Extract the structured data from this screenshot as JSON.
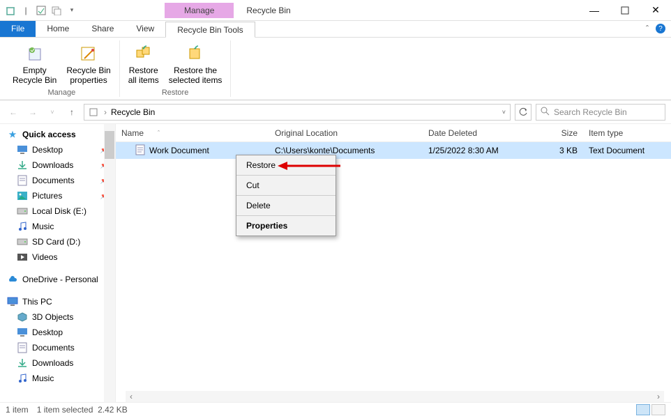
{
  "title": "Recycle Bin",
  "manage_tab": "Manage",
  "menutabs": {
    "file": "File",
    "home": "Home",
    "share": "Share",
    "view": "View",
    "tools": "Recycle Bin Tools"
  },
  "ribbon": {
    "manage": {
      "empty": "Empty\nRecycle Bin",
      "props": "Recycle Bin\nproperties",
      "group": "Manage"
    },
    "restore": {
      "all": "Restore\nall items",
      "sel": "Restore the\nselected items",
      "group": "Restore"
    }
  },
  "address": {
    "path": "Recycle Bin"
  },
  "search": {
    "placeholder": "Search Recycle Bin"
  },
  "sidebar": {
    "quick": "Quick access",
    "items": [
      {
        "label": "Desktop",
        "icon": "desktop",
        "pin": true
      },
      {
        "label": "Downloads",
        "icon": "downloads",
        "pin": true
      },
      {
        "label": "Documents",
        "icon": "documents",
        "pin": true
      },
      {
        "label": "Pictures",
        "icon": "pictures",
        "pin": true
      },
      {
        "label": "Local Disk (E:)",
        "icon": "disk",
        "pin": false
      },
      {
        "label": "Music",
        "icon": "music",
        "pin": false
      },
      {
        "label": "SD Card (D:)",
        "icon": "disk",
        "pin": false
      },
      {
        "label": "Videos",
        "icon": "videos",
        "pin": false
      }
    ],
    "onedrive": "OneDrive - Personal",
    "thispc": "This PC",
    "pc_items": [
      {
        "label": "3D Objects"
      },
      {
        "label": "Desktop"
      },
      {
        "label": "Documents"
      },
      {
        "label": "Downloads"
      },
      {
        "label": "Music"
      }
    ]
  },
  "columns": {
    "name": "Name",
    "orig": "Original Location",
    "date": "Date Deleted",
    "size": "Size",
    "type": "Item type"
  },
  "file": {
    "name": "Work Document",
    "orig": "C:\\Users\\konte\\Documents",
    "date": "1/25/2022 8:30 AM",
    "size": "3 KB",
    "type": "Text Document"
  },
  "context": {
    "restore": "Restore",
    "cut": "Cut",
    "delete": "Delete",
    "props": "Properties"
  },
  "status": {
    "count": "1 item",
    "sel": "1 item selected",
    "size": "2.42 KB"
  }
}
